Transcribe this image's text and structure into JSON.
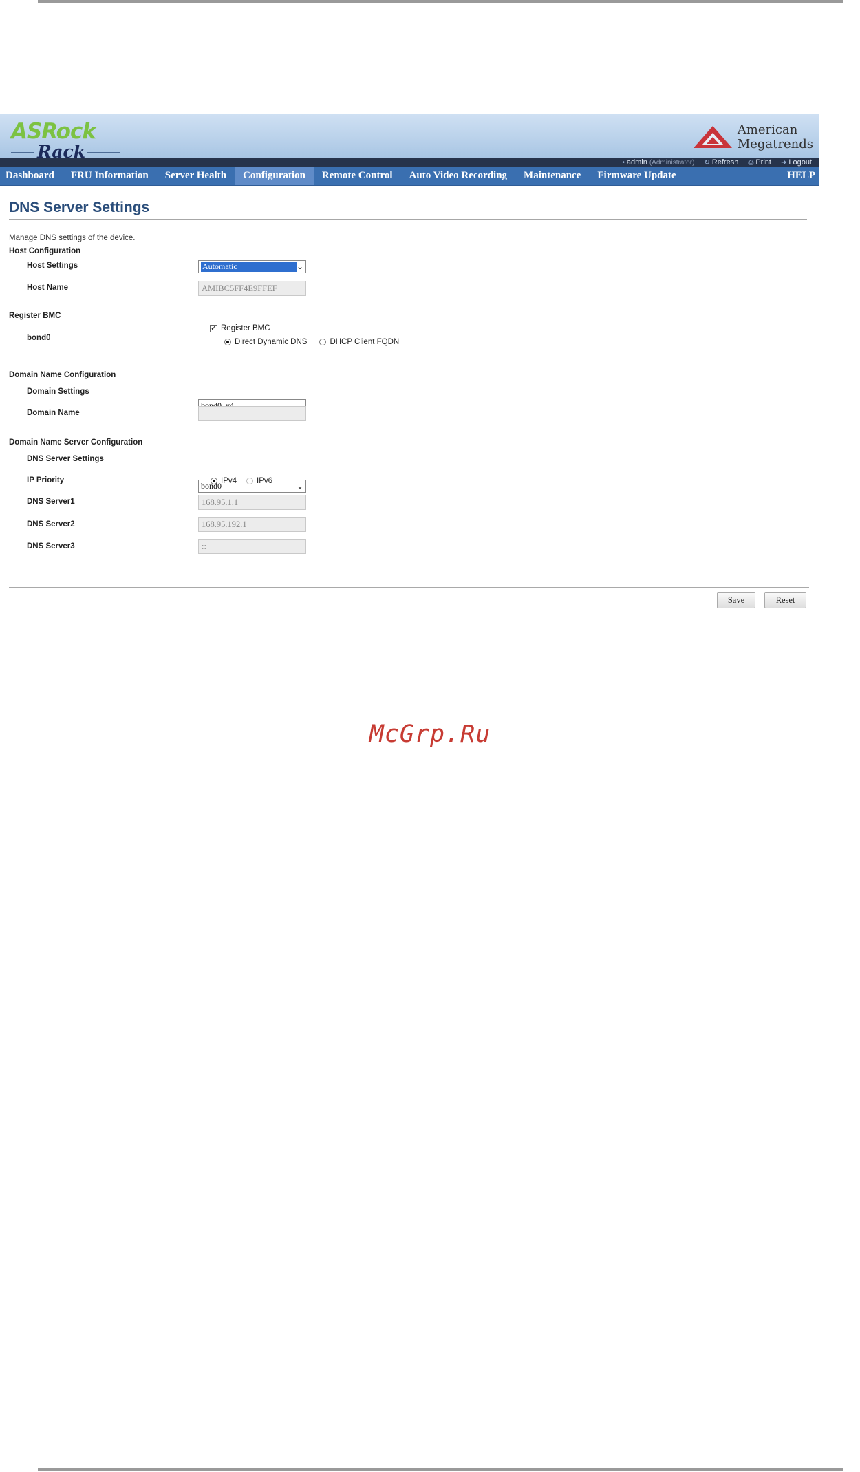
{
  "brand": {
    "line1": "ASRock",
    "line2": "Rack"
  },
  "vendor": {
    "line1": "American",
    "line2": "Megatrends"
  },
  "userbar": {
    "user": "admin",
    "role": "(Administrator)",
    "refresh": "Refresh",
    "print": "Print",
    "logout": "Logout"
  },
  "nav": {
    "items": [
      "Dashboard",
      "FRU Information",
      "Server Health",
      "Configuration",
      "Remote Control",
      "Auto Video Recording",
      "Maintenance",
      "Firmware Update"
    ],
    "active": "Configuration",
    "help": "HELP"
  },
  "page": {
    "title": "DNS Server Settings",
    "description": "Manage DNS settings of the device."
  },
  "host": {
    "section": "Host Configuration",
    "settings_label": "Host Settings",
    "settings_value": "Automatic",
    "name_label": "Host Name",
    "name_value": "AMIBC5FF4E9FFEF"
  },
  "register": {
    "section": "Register BMC",
    "iface_label": "bond0",
    "checkbox_label": "Register BMC",
    "checked": true,
    "option1": "Direct Dynamic DNS",
    "option2": "DHCP Client FQDN",
    "selected": "Direct Dynamic DNS"
  },
  "domain": {
    "section": "Domain Name Configuration",
    "settings_label": "Domain Settings",
    "settings_value": "bond0_v4",
    "name_label": "Domain Name",
    "name_value": ""
  },
  "dns": {
    "section": "Domain Name Server Configuration",
    "settings_label": "DNS Server Settings",
    "settings_value": "bond0",
    "priority_label": "IP Priority",
    "priority_v4": "IPv4",
    "priority_v6": "IPv6",
    "priority_selected": "IPv4",
    "server1_label": "DNS Server1",
    "server1_value": "168.95.1.1",
    "server2_label": "DNS Server2",
    "server2_value": "168.95.192.1",
    "server3_label": "DNS Server3",
    "server3_value": "::"
  },
  "buttons": {
    "save": "Save",
    "reset": "Reset"
  },
  "watermark": "McGrp.Ru",
  "colors": {
    "nav": "#3a6fb0",
    "nav_active": "#5f8bc8",
    "title": "#2a4d7a",
    "watermark": "#c73b33"
  }
}
